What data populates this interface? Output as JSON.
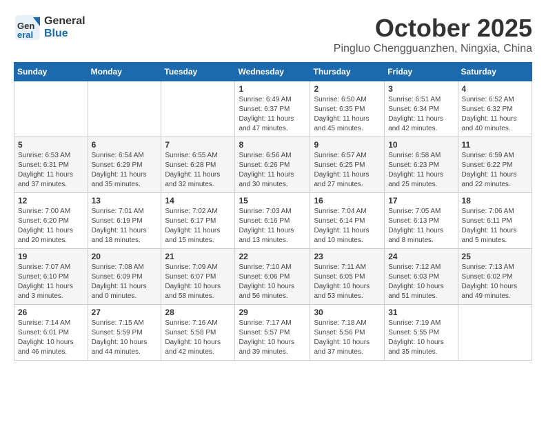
{
  "logo": {
    "general": "General",
    "blue": "Blue"
  },
  "title": "October 2025",
  "location": "Pingluo Chengguanzhen, Ningxia, China",
  "days_header": [
    "Sunday",
    "Monday",
    "Tuesday",
    "Wednesday",
    "Thursday",
    "Friday",
    "Saturday"
  ],
  "weeks": [
    [
      {
        "day": "",
        "info": ""
      },
      {
        "day": "",
        "info": ""
      },
      {
        "day": "",
        "info": ""
      },
      {
        "day": "1",
        "info": "Sunrise: 6:49 AM\nSunset: 6:37 PM\nDaylight: 11 hours\nand 47 minutes."
      },
      {
        "day": "2",
        "info": "Sunrise: 6:50 AM\nSunset: 6:35 PM\nDaylight: 11 hours\nand 45 minutes."
      },
      {
        "day": "3",
        "info": "Sunrise: 6:51 AM\nSunset: 6:34 PM\nDaylight: 11 hours\nand 42 minutes."
      },
      {
        "day": "4",
        "info": "Sunrise: 6:52 AM\nSunset: 6:32 PM\nDaylight: 11 hours\nand 40 minutes."
      }
    ],
    [
      {
        "day": "5",
        "info": "Sunrise: 6:53 AM\nSunset: 6:31 PM\nDaylight: 11 hours\nand 37 minutes."
      },
      {
        "day": "6",
        "info": "Sunrise: 6:54 AM\nSunset: 6:29 PM\nDaylight: 11 hours\nand 35 minutes."
      },
      {
        "day": "7",
        "info": "Sunrise: 6:55 AM\nSunset: 6:28 PM\nDaylight: 11 hours\nand 32 minutes."
      },
      {
        "day": "8",
        "info": "Sunrise: 6:56 AM\nSunset: 6:26 PM\nDaylight: 11 hours\nand 30 minutes."
      },
      {
        "day": "9",
        "info": "Sunrise: 6:57 AM\nSunset: 6:25 PM\nDaylight: 11 hours\nand 27 minutes."
      },
      {
        "day": "10",
        "info": "Sunrise: 6:58 AM\nSunset: 6:23 PM\nDaylight: 11 hours\nand 25 minutes."
      },
      {
        "day": "11",
        "info": "Sunrise: 6:59 AM\nSunset: 6:22 PM\nDaylight: 11 hours\nand 22 minutes."
      }
    ],
    [
      {
        "day": "12",
        "info": "Sunrise: 7:00 AM\nSunset: 6:20 PM\nDaylight: 11 hours\nand 20 minutes."
      },
      {
        "day": "13",
        "info": "Sunrise: 7:01 AM\nSunset: 6:19 PM\nDaylight: 11 hours\nand 18 minutes."
      },
      {
        "day": "14",
        "info": "Sunrise: 7:02 AM\nSunset: 6:17 PM\nDaylight: 11 hours\nand 15 minutes."
      },
      {
        "day": "15",
        "info": "Sunrise: 7:03 AM\nSunset: 6:16 PM\nDaylight: 11 hours\nand 13 minutes."
      },
      {
        "day": "16",
        "info": "Sunrise: 7:04 AM\nSunset: 6:14 PM\nDaylight: 11 hours\nand 10 minutes."
      },
      {
        "day": "17",
        "info": "Sunrise: 7:05 AM\nSunset: 6:13 PM\nDaylight: 11 hours\nand 8 minutes."
      },
      {
        "day": "18",
        "info": "Sunrise: 7:06 AM\nSunset: 6:11 PM\nDaylight: 11 hours\nand 5 minutes."
      }
    ],
    [
      {
        "day": "19",
        "info": "Sunrise: 7:07 AM\nSunset: 6:10 PM\nDaylight: 11 hours\nand 3 minutes."
      },
      {
        "day": "20",
        "info": "Sunrise: 7:08 AM\nSunset: 6:09 PM\nDaylight: 11 hours\nand 0 minutes."
      },
      {
        "day": "21",
        "info": "Sunrise: 7:09 AM\nSunset: 6:07 PM\nDaylight: 10 hours\nand 58 minutes."
      },
      {
        "day": "22",
        "info": "Sunrise: 7:10 AM\nSunset: 6:06 PM\nDaylight: 10 hours\nand 56 minutes."
      },
      {
        "day": "23",
        "info": "Sunrise: 7:11 AM\nSunset: 6:05 PM\nDaylight: 10 hours\nand 53 minutes."
      },
      {
        "day": "24",
        "info": "Sunrise: 7:12 AM\nSunset: 6:03 PM\nDaylight: 10 hours\nand 51 minutes."
      },
      {
        "day": "25",
        "info": "Sunrise: 7:13 AM\nSunset: 6:02 PM\nDaylight: 10 hours\nand 49 minutes."
      }
    ],
    [
      {
        "day": "26",
        "info": "Sunrise: 7:14 AM\nSunset: 6:01 PM\nDaylight: 10 hours\nand 46 minutes."
      },
      {
        "day": "27",
        "info": "Sunrise: 7:15 AM\nSunset: 5:59 PM\nDaylight: 10 hours\nand 44 minutes."
      },
      {
        "day": "28",
        "info": "Sunrise: 7:16 AM\nSunset: 5:58 PM\nDaylight: 10 hours\nand 42 minutes."
      },
      {
        "day": "29",
        "info": "Sunrise: 7:17 AM\nSunset: 5:57 PM\nDaylight: 10 hours\nand 39 minutes."
      },
      {
        "day": "30",
        "info": "Sunrise: 7:18 AM\nSunset: 5:56 PM\nDaylight: 10 hours\nand 37 minutes."
      },
      {
        "day": "31",
        "info": "Sunrise: 7:19 AM\nSunset: 5:55 PM\nDaylight: 10 hours\nand 35 minutes."
      },
      {
        "day": "",
        "info": ""
      }
    ]
  ]
}
